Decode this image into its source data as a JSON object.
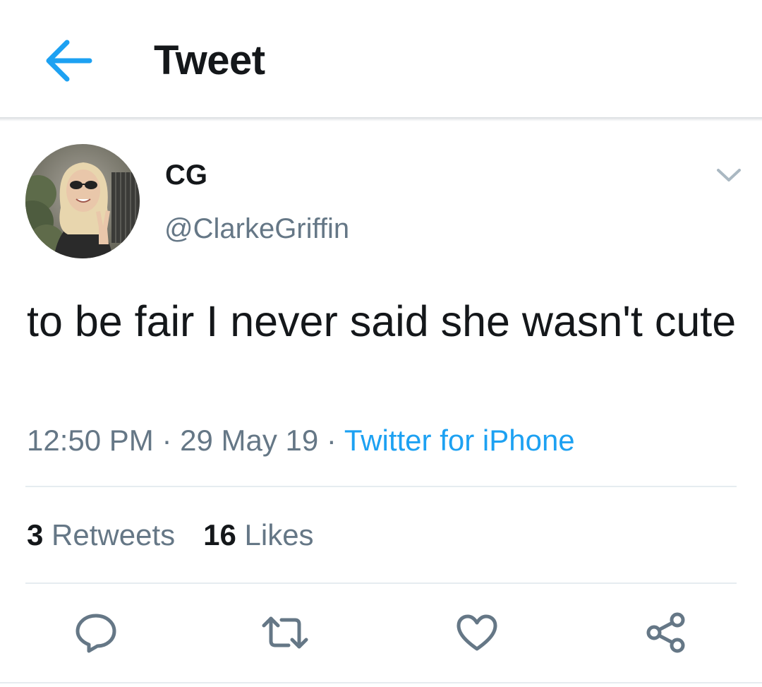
{
  "header": {
    "title": "Tweet",
    "back_icon": "arrow-left-icon"
  },
  "tweet": {
    "author": {
      "display_name": "CG",
      "handle": "@ClarkeGriffin"
    },
    "text": "to be fair I never said she wasn't cute",
    "time": "12:50 PM",
    "separator": "·",
    "date": "29 May 19",
    "source": "Twitter for iPhone",
    "stats": {
      "retweets_count": "3",
      "retweets_label": "Retweets",
      "likes_count": "16",
      "likes_label": "Likes"
    },
    "actions": [
      "reply-icon",
      "retweet-icon",
      "like-icon",
      "share-icon"
    ]
  },
  "colors": {
    "accent": "#1da1f2",
    "primary_text": "#14171a",
    "secondary_text": "#657786",
    "icon_gray": "#657786",
    "divider": "#e6ecf0"
  }
}
